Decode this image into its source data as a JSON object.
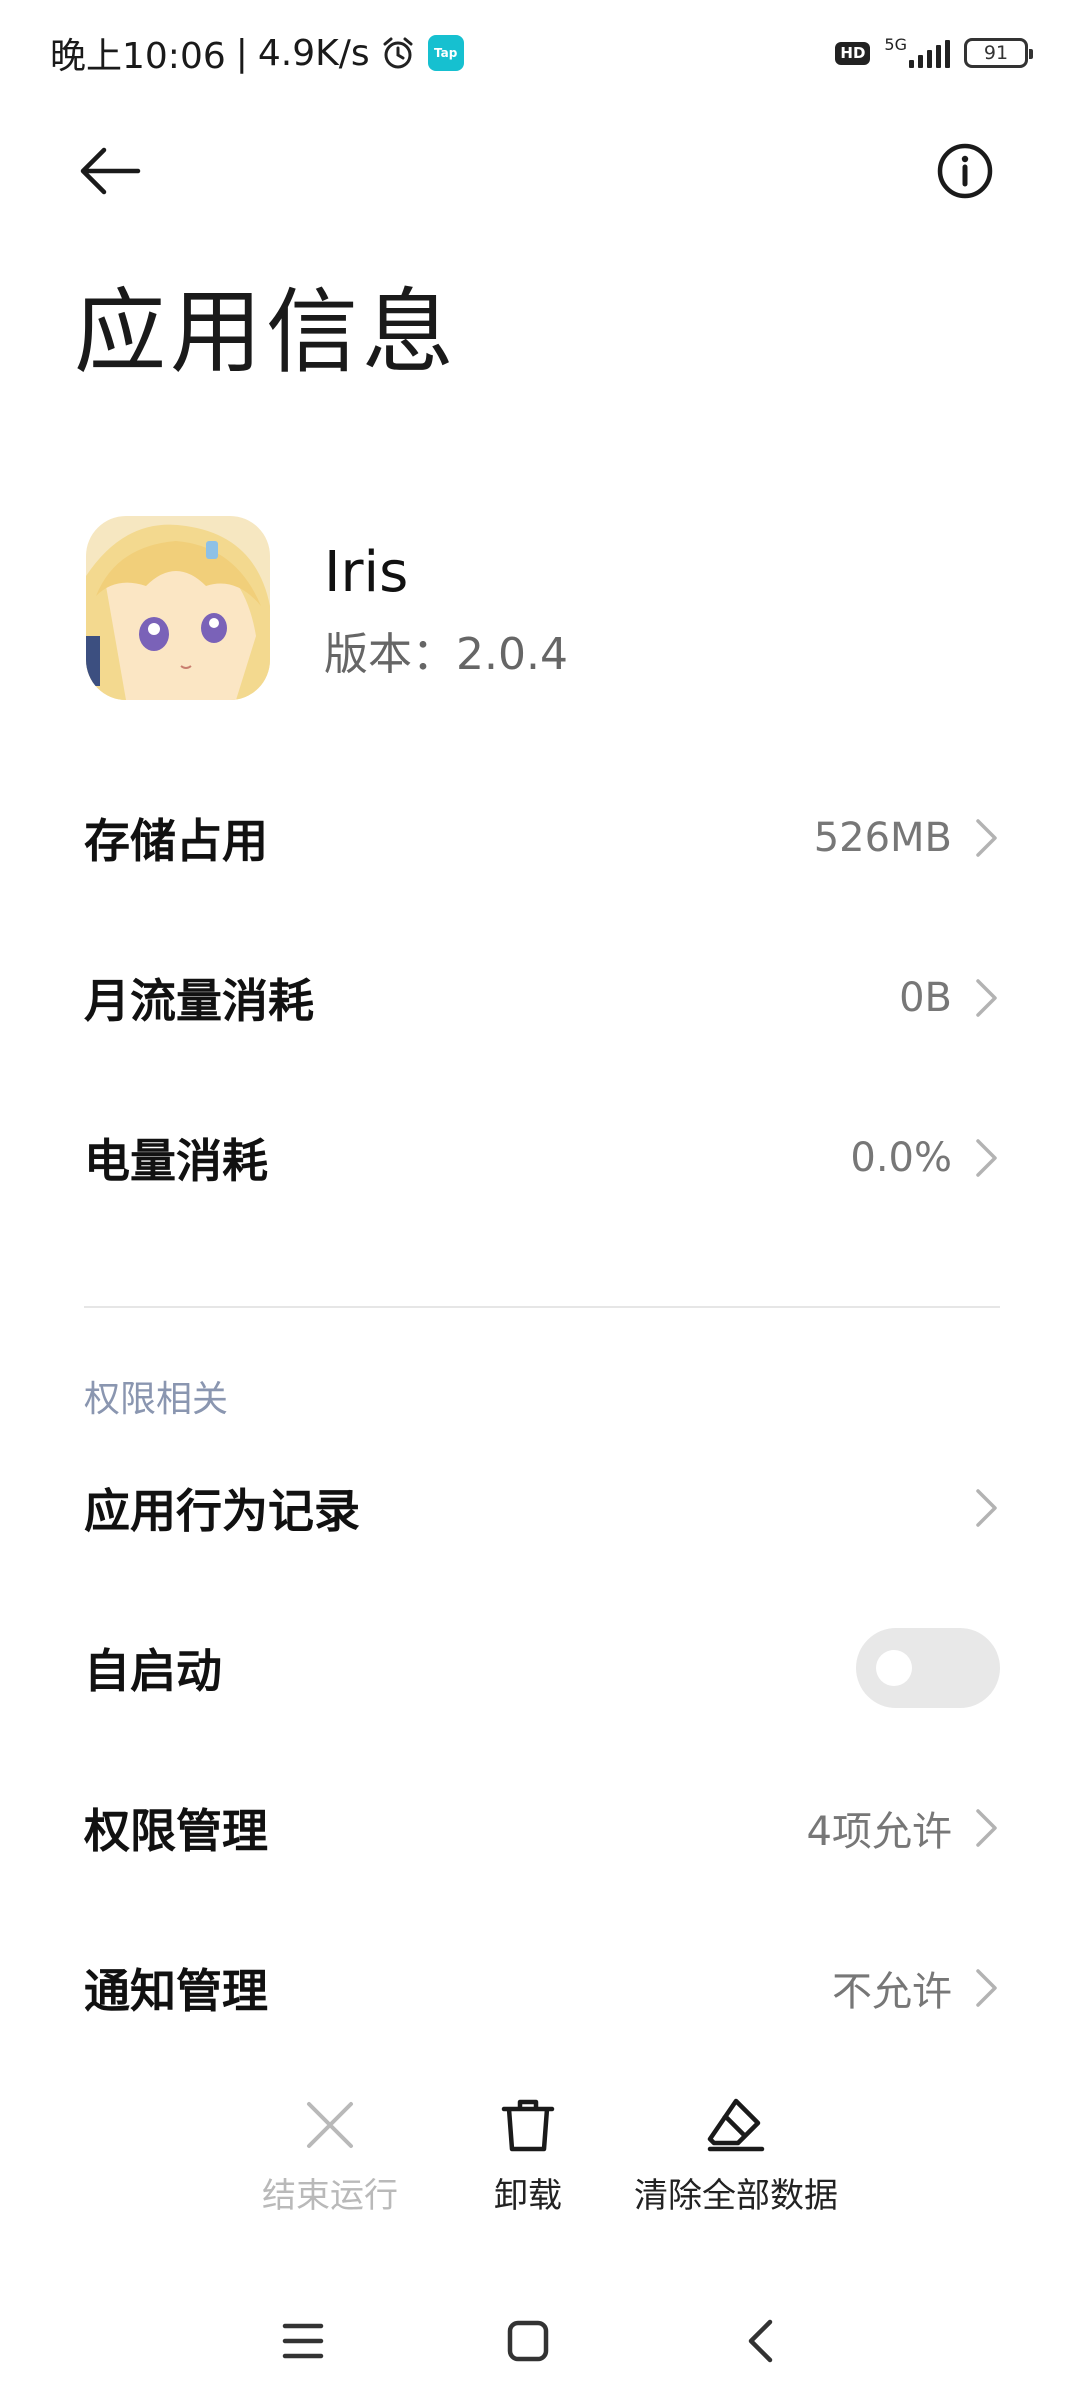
{
  "status_bar": {
    "time": "晚上10:06",
    "separator": "|",
    "speed": "4.9K/s",
    "tap_label": "Tap",
    "hd_label": "HD",
    "network_label": "5G",
    "battery": "91"
  },
  "header": {
    "title": "应用信息"
  },
  "app": {
    "name": "Iris",
    "version": "版本：2.0.4"
  },
  "usage_rows": [
    {
      "label": "存储占用",
      "value": "526MB"
    },
    {
      "label": "月流量消耗",
      "value": "0B"
    },
    {
      "label": "电量消耗",
      "value": "0.0%"
    }
  ],
  "permissions": {
    "section_title": "权限相关",
    "rows": [
      {
        "label": "应用行为记录",
        "value": ""
      },
      {
        "label": "自启动",
        "toggle": false
      },
      {
        "label": "权限管理",
        "value": "4项允许"
      },
      {
        "label": "通知管理",
        "value": "不允许"
      }
    ]
  },
  "actions": [
    {
      "label": "结束运行",
      "icon": "close-icon",
      "enabled": false
    },
    {
      "label": "卸载",
      "icon": "trash-icon",
      "enabled": true
    },
    {
      "label": "清除全部数据",
      "icon": "eraser-icon",
      "enabled": true
    }
  ],
  "nav": {
    "menu": "menu-icon",
    "home": "home-icon",
    "back": "back-icon"
  },
  "colors": {
    "section": "#8a96b0",
    "value": "#777777",
    "disabled": "#b9b9b9",
    "toggle_off": "#e8e8e8"
  }
}
